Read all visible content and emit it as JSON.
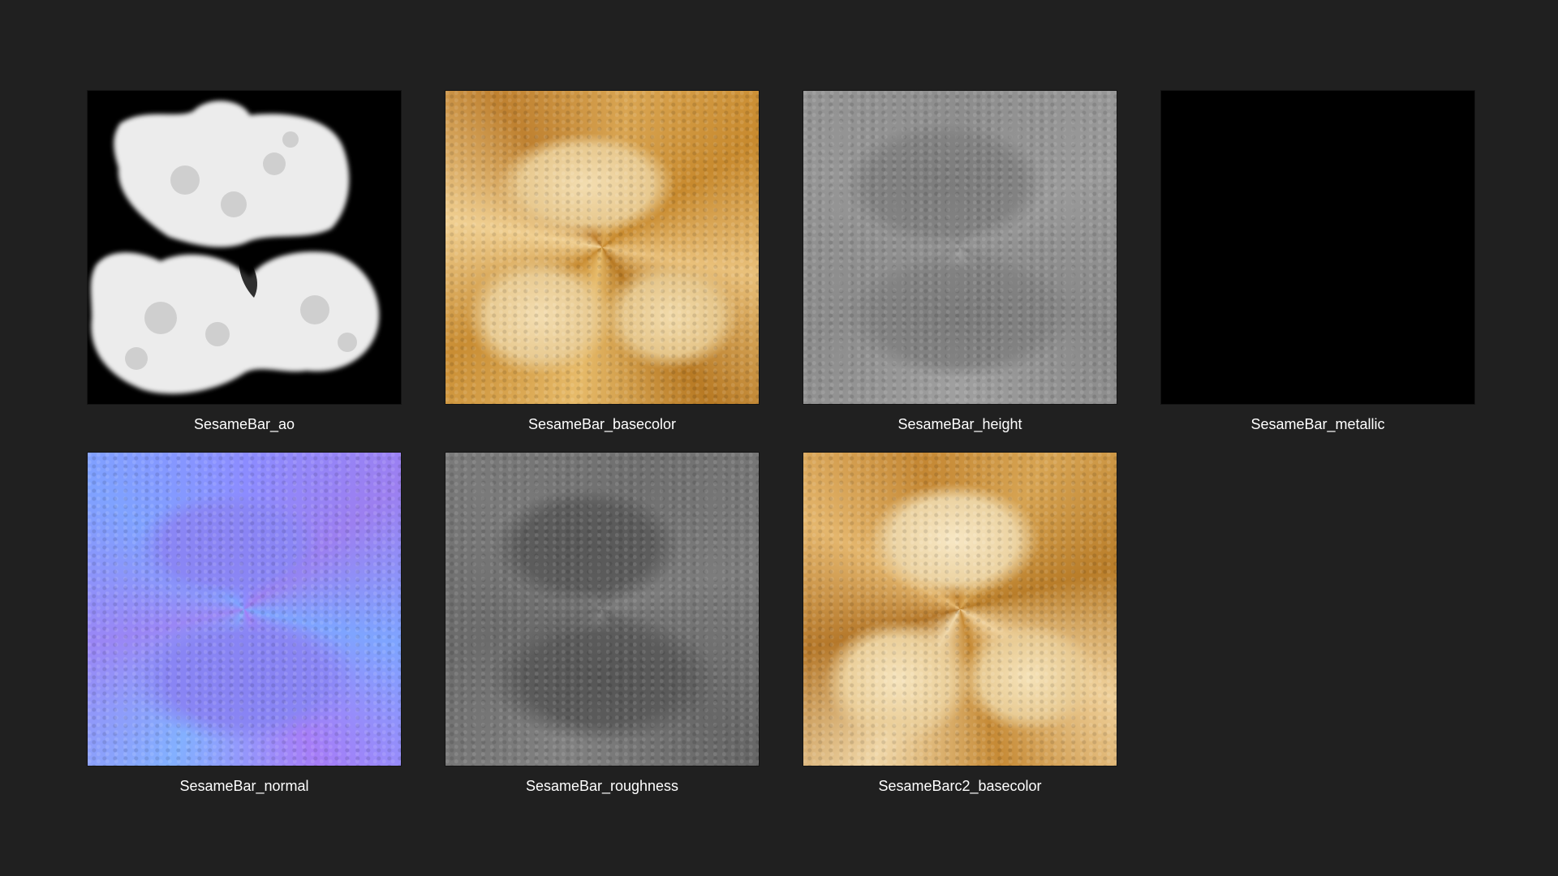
{
  "files": [
    {
      "name": "SesameBar_ao",
      "icon": "ao-texture-thumbnail"
    },
    {
      "name": "SesameBar_basecolor",
      "icon": "basecolor-texture-thumbnail"
    },
    {
      "name": "SesameBar_height",
      "icon": "height-texture-thumbnail"
    },
    {
      "name": "SesameBar_metallic",
      "icon": "metallic-texture-thumbnail"
    },
    {
      "name": "SesameBar_normal",
      "icon": "normal-texture-thumbnail"
    },
    {
      "name": "SesameBar_roughness",
      "icon": "roughness-texture-thumbnail"
    },
    {
      "name": "SesameBarc2_basecolor",
      "icon": "basecolor-texture-thumbnail"
    }
  ],
  "colors": {
    "background": "#202020",
    "label": "#ffffff"
  }
}
